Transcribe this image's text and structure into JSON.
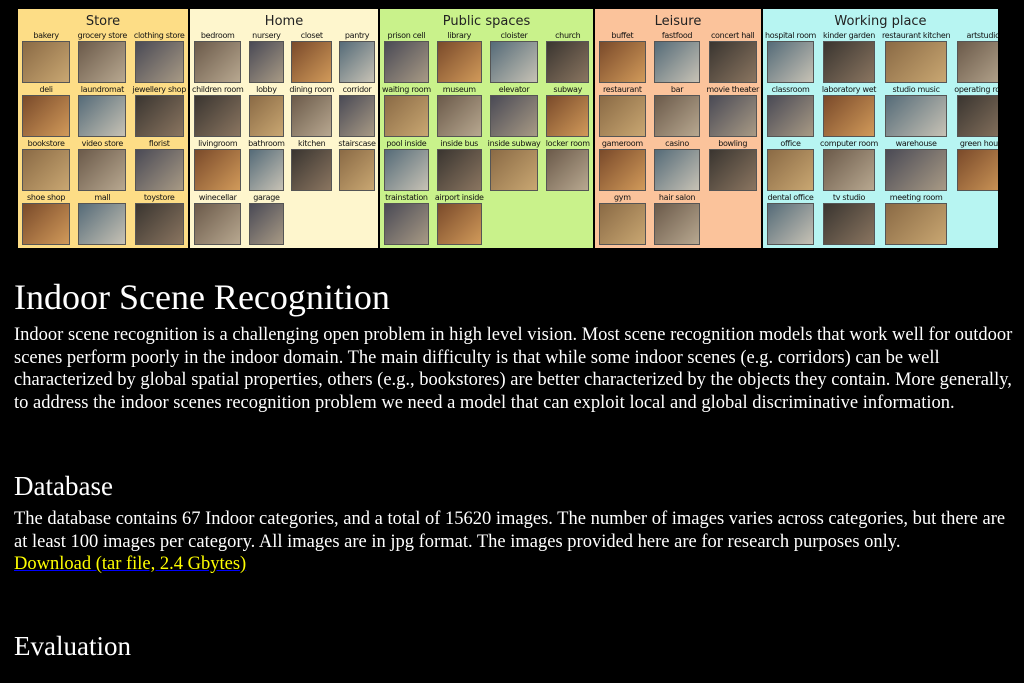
{
  "banner": {
    "panels": [
      {
        "title": "Store",
        "items": [
          "bakery",
          "grocery store",
          "clothing store",
          "deli",
          "laundromat",
          "jewellery shop",
          "bookstore",
          "video store",
          "florist",
          "shoe shop",
          "mall",
          "toystore"
        ]
      },
      {
        "title": "Home",
        "items": [
          "bedroom",
          "nursery",
          "closet",
          "pantry",
          "children room",
          "lobby",
          "dining room",
          "corridor",
          "livingroom",
          "bathroom",
          "kitchen",
          "stairscase",
          "winecellar",
          "garage"
        ]
      },
      {
        "title": "Public spaces",
        "items": [
          "prison cell",
          "library",
          "cloister",
          "church",
          "waiting room",
          "museum",
          "elevator",
          "subway",
          "pool inside",
          "inside bus",
          "inside subway",
          "locker room",
          "trainstation",
          "airport inside"
        ]
      },
      {
        "title": "Leisure",
        "items": [
          "buffet",
          "fastfood",
          "concert hall",
          "restaurant",
          "bar",
          "movie theater",
          "gameroom",
          "casino",
          "bowling",
          "gym",
          "hair salon"
        ]
      },
      {
        "title": "Working place",
        "items": [
          "hospital room",
          "kinder garden",
          "restaurant kitchen",
          "artstudio",
          "classroom",
          "laboratory wet",
          "studio music",
          "operating room",
          "office",
          "computer room",
          "warehouse",
          "green house",
          "dental office",
          "tv studio",
          "meeting room"
        ]
      }
    ]
  },
  "title": "Indoor Scene Recognition",
  "intro": "Indoor scene recognition is a challenging open problem in high level vision. Most scene recognition models that work well for outdoor scenes perform poorly in the indoor domain. The main difficulty is that while some indoor scenes (e.g. corridors) can be well characterized by global spatial properties, others (e.g., bookstores) are better characterized by the objects they contain. More generally, to address the indoor scenes recognition problem we need a model that can exploit local and global discriminative information.",
  "database": {
    "heading": "Database",
    "text": "The database contains 67 Indoor categories, and a total of 15620 images. The number of images varies across categories, but there are at least 100 images per category. All images are in jpg format. The images provided here are for research purposes only.",
    "download_link": "Download (tar file, 2.4 Gbytes)"
  },
  "evaluation": {
    "heading": "Evaluation"
  }
}
